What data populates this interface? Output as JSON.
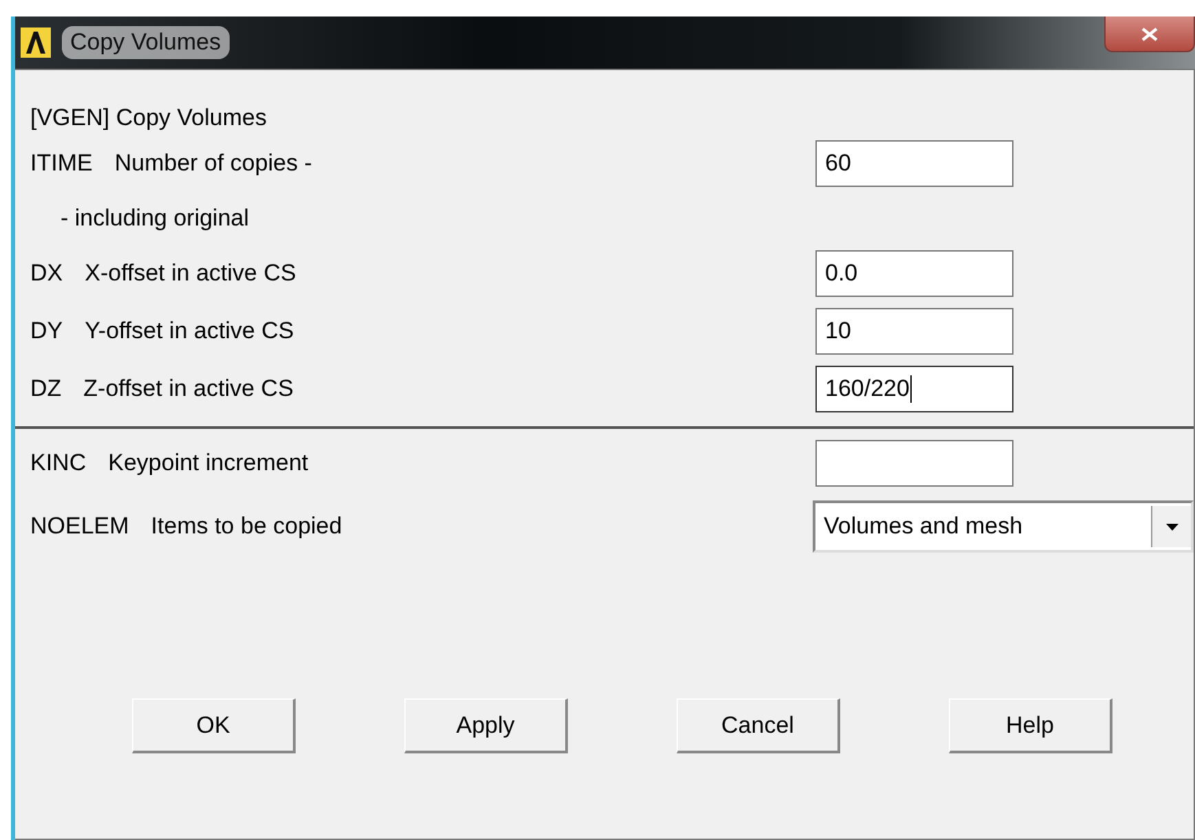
{
  "window": {
    "title": "Copy Volumes"
  },
  "heading": "[VGEN]  Copy Volumes",
  "sections": [
    {
      "rows": [
        {
          "kind": "field",
          "code": "ITIME",
          "label": "Number of copies -",
          "value": "60",
          "focused": false
        },
        {
          "kind": "note",
          "label": "- including original"
        },
        {
          "kind": "field",
          "code": "DX",
          "label": "X-offset in active CS",
          "value": "0.0",
          "focused": false
        },
        {
          "kind": "field",
          "code": "DY",
          "label": "Y-offset in active CS",
          "value": "10",
          "focused": false
        },
        {
          "kind": "field",
          "code": "DZ",
          "label": "Z-offset in active CS",
          "value": "160/220",
          "focused": true
        }
      ]
    },
    {
      "rows": [
        {
          "kind": "field",
          "code": "KINC",
          "label": "Keypoint increment",
          "focused": false
        },
        {
          "kind": "dropdown",
          "code": "NOELEM",
          "label": "Items to be copied",
          "value": "Volumes and mesh"
        }
      ]
    }
  ],
  "buttons": [
    "OK",
    "Apply",
    "Cancel",
    "Help"
  ]
}
